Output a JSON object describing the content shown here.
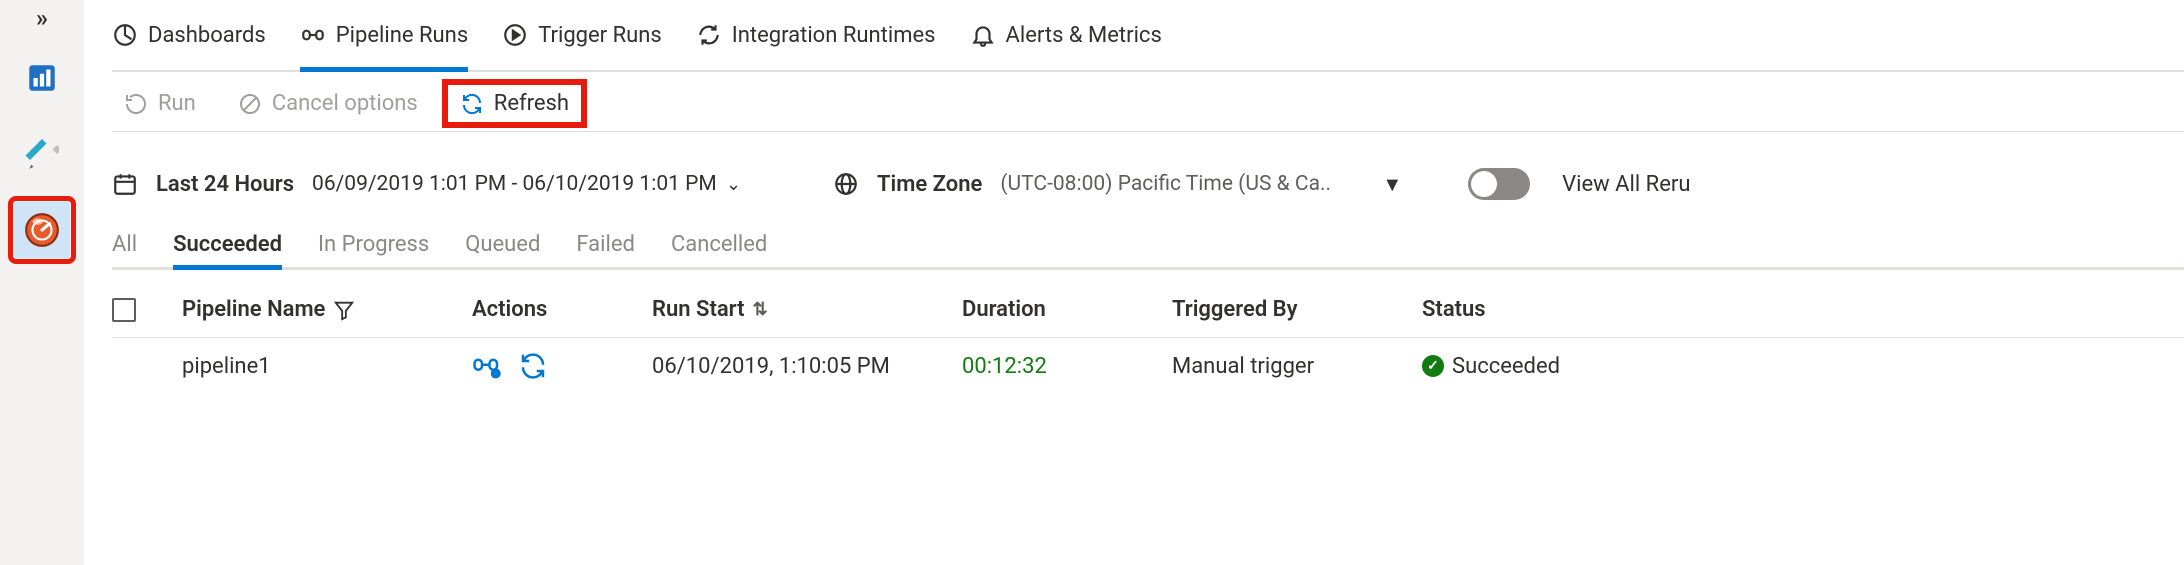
{
  "sidebar": {
    "expandGlyph": "»",
    "items": [
      {
        "name": "overview",
        "kind": "chart"
      },
      {
        "name": "author",
        "kind": "pencil"
      },
      {
        "name": "monitor",
        "kind": "gauge",
        "selected": true,
        "highlighted": true
      }
    ]
  },
  "topTabs": [
    {
      "icon": "dashboard",
      "label": "Dashboards"
    },
    {
      "icon": "pipeline",
      "label": "Pipeline Runs",
      "active": true
    },
    {
      "icon": "play",
      "label": "Trigger Runs"
    },
    {
      "icon": "ir",
      "label": "Integration Runtimes"
    },
    {
      "icon": "bell",
      "label": "Alerts & Metrics"
    }
  ],
  "toolbar": {
    "run": {
      "label": "Run"
    },
    "cancel": {
      "label": "Cancel options"
    },
    "refresh": {
      "label": "Refresh",
      "highlighted": true
    }
  },
  "filter": {
    "rangeLabel": "Last 24 Hours",
    "rangeValue": "06/09/2019 1:01 PM - 06/10/2019 1:01 PM",
    "tzLabel": "Time Zone",
    "tzValue": "(UTC-08:00) Pacific Time (US & Ca...",
    "toggleLabel": "View All Reru"
  },
  "statusTabs": [
    "All",
    "Succeeded",
    "In Progress",
    "Queued",
    "Failed",
    "Cancelled"
  ],
  "statusActive": "Succeeded",
  "table": {
    "columns": {
      "pipelineName": "Pipeline Name",
      "actions": "Actions",
      "runStart": "Run Start",
      "duration": "Duration",
      "triggeredBy": "Triggered By",
      "status": "Status"
    },
    "rows": [
      {
        "pipelineName": "pipeline1",
        "runStart": "06/10/2019, 1:10:05 PM",
        "duration": "00:12:32",
        "triggeredBy": "Manual trigger",
        "status": "Succeeded"
      }
    ]
  }
}
